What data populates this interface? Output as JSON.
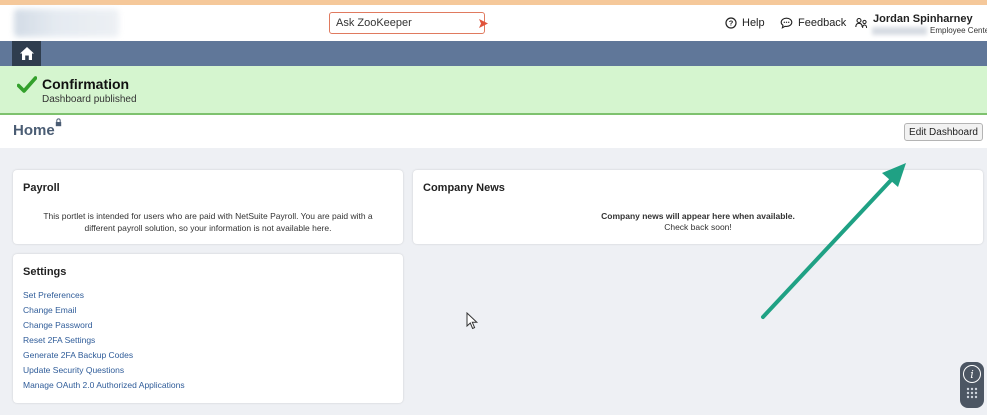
{
  "header": {
    "search": {
      "placeholder": "Ask ZooKeeper"
    },
    "help_label": "Help",
    "feedback_label": "Feedback",
    "user": {
      "name": "Jordan Spinharney",
      "role": "Employee Center"
    }
  },
  "navbar": {
    "home_icon": "home-icon"
  },
  "confirmation": {
    "title": "Confirmation",
    "message": "Dashboard published"
  },
  "page": {
    "title": "Home",
    "edit_button": "Edit Dashboard"
  },
  "portlets": {
    "payroll": {
      "title": "Payroll",
      "text": "This portlet is intended for users who are paid with NetSuite Payroll. You are paid with a different payroll solution, so your information is not available here."
    },
    "company_news": {
      "title": "Company News",
      "line1": "Company news will appear here when available.",
      "line2": "Check back soon!"
    },
    "settings": {
      "title": "Settings",
      "links": [
        {
          "label": "Set Preferences"
        },
        {
          "label": "Change Email"
        },
        {
          "label": "Change Password"
        },
        {
          "label": "Reset 2FA Settings"
        },
        {
          "label": "Generate 2FA Backup Codes"
        },
        {
          "label": "Update Security Questions"
        },
        {
          "label": "Manage OAuth 2.0 Authorized Applications"
        }
      ]
    }
  },
  "colors": {
    "accent_orange": "#e07a5f",
    "nav_blue": "#607799",
    "confirm_green": "#d5f5cf",
    "link_blue": "#2f5c99",
    "annotation_arrow": "#1fa184"
  }
}
